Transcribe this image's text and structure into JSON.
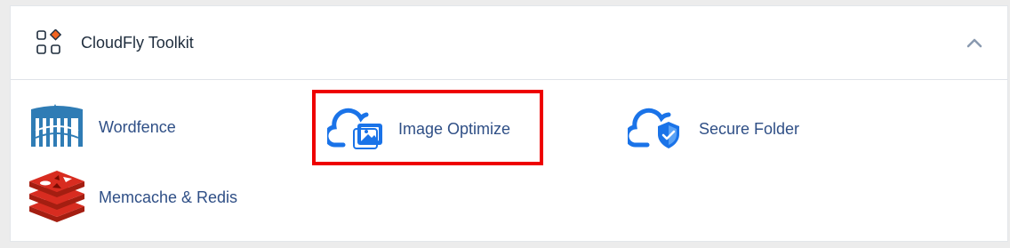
{
  "header": {
    "title": "CloudFly Toolkit"
  },
  "tools": [
    {
      "label": "Wordfence",
      "icon": "wordfence-icon"
    },
    {
      "label": "Image Optimize",
      "icon": "image-optimize-icon"
    },
    {
      "label": "Secure Folder",
      "icon": "secure-folder-icon"
    },
    {
      "label": "Memcache & Redis",
      "icon": "redis-icon"
    }
  ],
  "colors": {
    "accent_blue": "#1a73e8",
    "label_blue": "#2f4f86",
    "highlight_red": "#ee0000",
    "diamond_orange": "#f26522",
    "wordfence_blue": "#2f7cb5",
    "redis_red": "#c6302b"
  }
}
